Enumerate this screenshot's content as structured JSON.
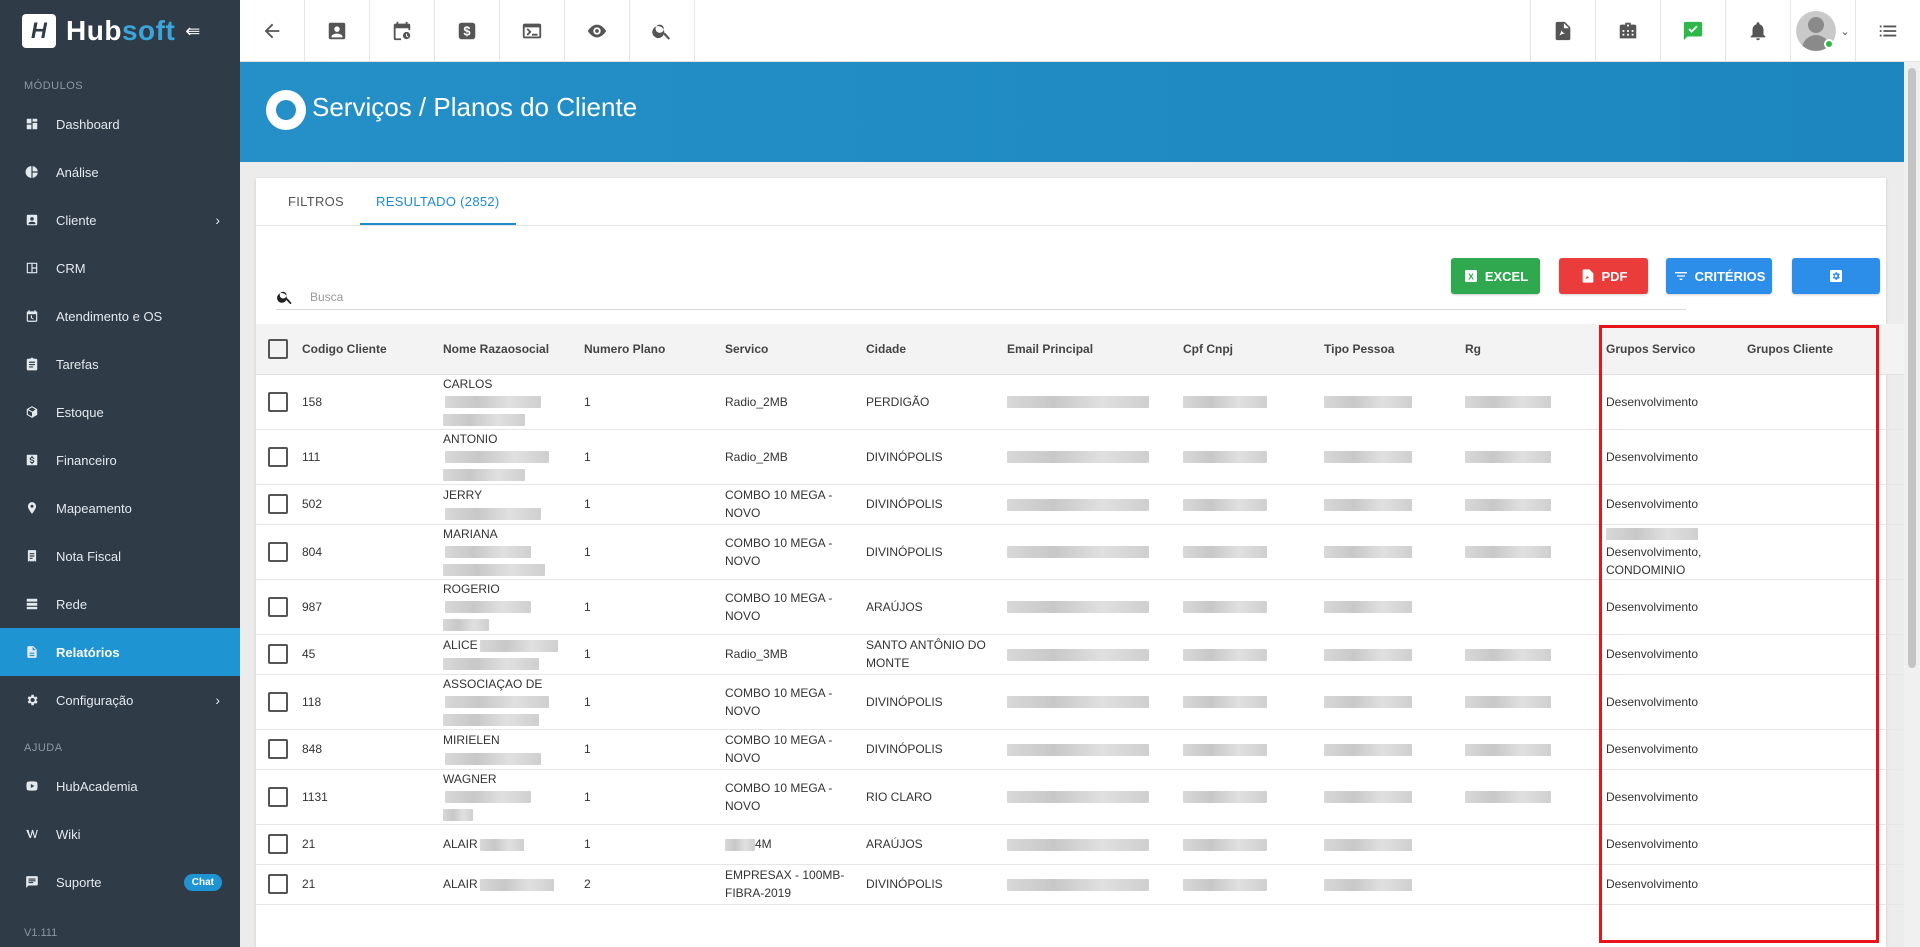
{
  "brand": {
    "name_a": "Hub",
    "name_b": "soft",
    "logo_letter": "H",
    "toggle_icon": "menu-collapse-icon"
  },
  "sidebar": {
    "section_modules": "MÓDULOS",
    "items": [
      {
        "label": "Dashboard",
        "icon": "dashboard-icon"
      },
      {
        "label": "Análise",
        "icon": "pie-chart-icon"
      },
      {
        "label": "Cliente",
        "icon": "contact-card-icon",
        "chevron": "›"
      },
      {
        "label": "CRM",
        "icon": "crm-icon"
      },
      {
        "label": "Atendimento e OS",
        "icon": "calendar-clock-icon"
      },
      {
        "label": "Tarefas",
        "icon": "tasks-icon"
      },
      {
        "label": "Estoque",
        "icon": "box-icon"
      },
      {
        "label": "Financeiro",
        "icon": "dollar-icon"
      },
      {
        "label": "Mapeamento",
        "icon": "map-pin-icon"
      },
      {
        "label": "Nota Fiscal",
        "icon": "receipt-icon"
      },
      {
        "label": "Rede",
        "icon": "server-icon"
      },
      {
        "label": "Relatórios",
        "icon": "report-icon",
        "active": true
      },
      {
        "label": "Configuração",
        "icon": "gear-icon",
        "chevron": "›"
      }
    ],
    "section_help": "AJUDA",
    "help_items": [
      {
        "label": "HubAcademia",
        "icon": "youtube-icon"
      },
      {
        "label": "Wiki",
        "icon": "wiki-icon"
      },
      {
        "label": "Suporte",
        "icon": "chat-icon",
        "badge": "Chat"
      }
    ],
    "version": "V1.111"
  },
  "header": {
    "title": "Serviços / Planos do Cliente"
  },
  "tabs": [
    {
      "label": "FILTROS"
    },
    {
      "label": "RESULTADO (2852)",
      "active": true
    }
  ],
  "search": {
    "placeholder": "Busca"
  },
  "buttons": {
    "excel": "EXCEL",
    "pdf": "PDF",
    "criterios": "CRITÉRIOS"
  },
  "table": {
    "columns": [
      "Codigo Cliente",
      "Nome Razaosocial",
      "Numero Plano",
      "Servico",
      "Cidade",
      "Email Principal",
      "Cpf Cnpj",
      "Tipo Pessoa",
      "Rg",
      "Grupos Servico",
      "Grupos Cliente"
    ],
    "rows": [
      {
        "codigo": "158",
        "nome": "CARLOS",
        "plano": "1",
        "servico": "Radio_2MB",
        "cidade": "PERDIGÃO",
        "grupos_servico": "Desenvolvimento"
      },
      {
        "codigo": "111",
        "nome": "ANTONIO",
        "plano": "1",
        "servico": "Radio_2MB",
        "cidade": "DIVINÓPOLIS",
        "grupos_servico": "Desenvolvimento"
      },
      {
        "codigo": "502",
        "nome": "JERRY",
        "plano": "1",
        "servico": "COMBO 10 MEGA - NOVO",
        "cidade": "DIVINÓPOLIS",
        "grupos_servico": "Desenvolvimento"
      },
      {
        "codigo": "804",
        "nome": "MARIANA",
        "plano": "1",
        "servico": "COMBO 10 MEGA - NOVO",
        "cidade": "DIVINÓPOLIS",
        "grupos_servico": "Desenvolvimento, CONDOMINIO"
      },
      {
        "codigo": "987",
        "nome": "ROGERIO",
        "plano": "1",
        "servico": "COMBO 10 MEGA - NOVO",
        "cidade": "ARAÚJOS",
        "grupos_servico": "Desenvolvimento"
      },
      {
        "codigo": "45",
        "nome": "ALICE",
        "plano": "1",
        "servico": "Radio_3MB",
        "cidade": "SANTO ANTÔNIO DO MONTE",
        "grupos_servico": "Desenvolvimento"
      },
      {
        "codigo": "118",
        "nome": "ASSOCIAÇAO DE",
        "plano": "1",
        "servico": "COMBO 10 MEGA - NOVO",
        "cidade": "DIVINÓPOLIS",
        "grupos_servico": "Desenvolvimento"
      },
      {
        "codigo": "848",
        "nome": "MIRIELEN",
        "plano": "1",
        "servico": "COMBO 10 MEGA - NOVO",
        "cidade": "DIVINÓPOLIS",
        "grupos_servico": "Desenvolvimento"
      },
      {
        "codigo": "1131",
        "nome": "WAGNER",
        "plano": "1",
        "servico": "COMBO 10 MEGA - NOVO",
        "cidade": "RIO CLARO",
        "grupos_servico": "Desenvolvimento"
      },
      {
        "codigo": "21",
        "nome": "ALAIR",
        "plano": "1",
        "servico": "4M",
        "cidade": "ARAÚJOS",
        "grupos_servico": "Desenvolvimento"
      },
      {
        "codigo": "21",
        "nome": "ALAIR",
        "plano": "2",
        "servico": "EMPRESAX - 100MB-FIBRA-2019",
        "cidade": "DIVINÓPOLIS",
        "grupos_servico": "Desenvolvimento"
      }
    ]
  },
  "colors": {
    "sidebar_bg": "#2f3b47",
    "accent": "#1f94d2",
    "excel": "#2fa84f",
    "pdf": "#ea3d3b",
    "highlight": "#e8141a"
  }
}
